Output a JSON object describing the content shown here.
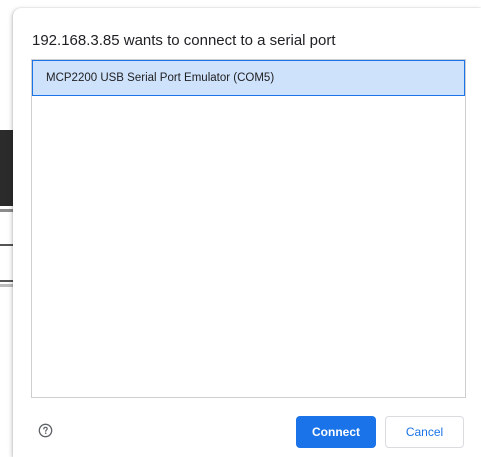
{
  "dialog": {
    "title": "192.168.3.85 wants to connect to a serial port",
    "ports": [
      {
        "label": "MCP2200 USB Serial Port Emulator (COM5)",
        "selected": true
      }
    ],
    "help_icon": "help-circle-icon",
    "connect_label": "Connect",
    "cancel_label": "Cancel"
  },
  "colors": {
    "accent": "#1a73e8",
    "selection_background": "#cfe2fb",
    "text": "#202124"
  }
}
